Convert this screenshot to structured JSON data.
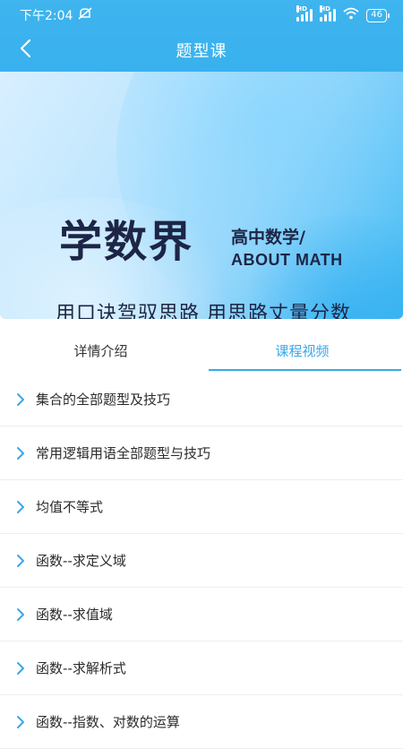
{
  "status": {
    "time": "下午2:04",
    "battery": "46"
  },
  "header": {
    "title": "题型课"
  },
  "banner": {
    "main": "学数界",
    "sub_cn": "高中数学/",
    "sub_en": "ABOUT MATH",
    "slogan": "用口诀驾驭思路 用思路丈量分数"
  },
  "tabs": [
    {
      "label": "详情介绍",
      "active": false
    },
    {
      "label": "课程视频",
      "active": true
    }
  ],
  "lessons": [
    "集合的全部题型及技巧",
    "常用逻辑用语全部题型与技巧",
    "均值不等式",
    "函数--求定义域",
    "函数--求值域",
    "函数--求解析式",
    "函数--指数、对数的运算"
  ],
  "colors": {
    "accent": "#3aa7e8",
    "topbar": "#3fb4ee",
    "banner_text": "#1d2546"
  },
  "icons": {
    "back": "chevron-left-icon",
    "item": "chevron-right-icon"
  }
}
